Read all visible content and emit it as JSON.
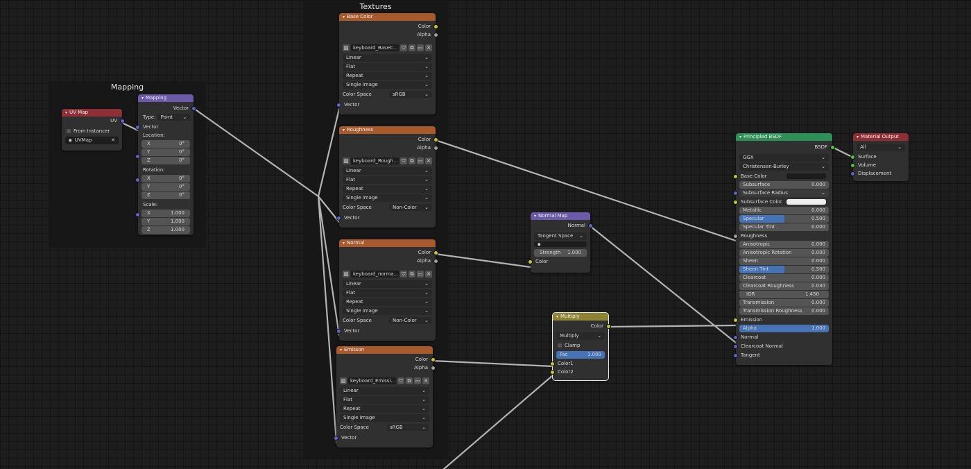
{
  "frames": {
    "mapping_title": "Mapping",
    "textures_title": "Textures"
  },
  "uvmap": {
    "title": "UV Map",
    "out_uv": "UV",
    "from_instancer": "From Instancer",
    "uvmap_value": "UVMap"
  },
  "mapping": {
    "title": "Mapping",
    "out_vector": "Vector",
    "type_label": "Type:",
    "type_value": "Point",
    "in_vector": "Vector",
    "location": "Location:",
    "rotation": "Rotation:",
    "scale": "Scale:",
    "x": "X",
    "y": "Y",
    "z": "Z",
    "loc": [
      "0°",
      "0°",
      "0°"
    ],
    "rot": [
      "0°",
      "0°",
      "0°"
    ],
    "scl": [
      "1.000",
      "1.000",
      "1.000"
    ]
  },
  "tex_common": {
    "out_color": "Color",
    "out_alpha": "Alpha",
    "interpolation": "Linear",
    "projection": "Flat",
    "extension": "Repeat",
    "source": "Single Image",
    "colorspace_label": "Color Space",
    "in_vector": "Vector",
    "icon_shield": "⛉",
    "icon_copy": "⧉",
    "icon_folder": "▭",
    "icon_close": "✕",
    "icon_image": "▨"
  },
  "tex_basecolor": {
    "title": "Base Color",
    "image": "keyboard_BaseC...",
    "colorspace": "sRGB"
  },
  "tex_roughness": {
    "title": "Roughness",
    "image": "keyboard_Rough...",
    "colorspace": "Non-Color"
  },
  "tex_normal": {
    "title": "Normal",
    "image": "keyboard_norma...",
    "colorspace": "Non-Color"
  },
  "tex_emission": {
    "title": "Emisson",
    "image": "keyboard_Emissi...",
    "colorspace": "sRGB"
  },
  "normalmap": {
    "title": "Normal Map",
    "out_normal": "Normal",
    "space": "Tangent Space",
    "strength_label": "Strength",
    "strength_value": "1.000",
    "in_color": "Color"
  },
  "multiply": {
    "title": "Multiply",
    "out_color": "Color",
    "mode": "Multiply",
    "clamp": "Clamp",
    "fac_label": "Fac",
    "fac_value": "1.000",
    "color1": "Color1",
    "color2": "Color2"
  },
  "bsdf": {
    "title": "Principled BSDF",
    "out_bsdf": "BSDF",
    "distribution": "GGX",
    "subsurface_method": "Christensen-Burley",
    "base_color": "Base Color",
    "subsurface": "Subsurface",
    "subsurface_v": "0.000",
    "subsurface_radius": "Subsurface Radius",
    "subsurface_color": "Subsurface Color",
    "metallic": "Metallic",
    "metallic_v": "0.000",
    "specular": "Specular",
    "specular_v": "0.500",
    "specular_tint": "Specular Tint",
    "specular_tint_v": "0.000",
    "roughness": "Roughness",
    "anisotropic": "Anisotropic",
    "anisotropic_v": "0.000",
    "anisotropic_rotation": "Anisotropic Rotation",
    "anisotropic_rotation_v": "0.000",
    "sheen": "Sheen",
    "sheen_v": "0.000",
    "sheen_tint": "Sheen Tint",
    "sheen_tint_v": "0.500",
    "clearcoat": "Clearcoat",
    "clearcoat_v": "0.000",
    "clearcoat_roughness": "Clearcoat Roughness",
    "clearcoat_roughness_v": "0.030",
    "ior": "IOR",
    "ior_v": "1.450",
    "transmission": "Transmission",
    "transmission_v": "0.000",
    "transmission_roughness": "Transmission Roughness",
    "transmission_roughness_v": "0.000",
    "emission": "Emission",
    "alpha": "Alpha",
    "alpha_v": "1.000",
    "normal": "Normal",
    "clearcoat_normal": "Clearcoat Normal",
    "tangent": "Tangent"
  },
  "output": {
    "title": "Material Output",
    "target": "All",
    "surface": "Surface",
    "volume": "Volume",
    "displacement": "Displacement"
  },
  "colors": {
    "wire": "#b4b4b4",
    "header_texture": "#a75a2c",
    "header_shader": "#2f8f58",
    "header_input": "#8d2f35",
    "header_vector": "#6b5aa8",
    "header_color": "#8c8432",
    "slider_fill": "#4772b3"
  }
}
